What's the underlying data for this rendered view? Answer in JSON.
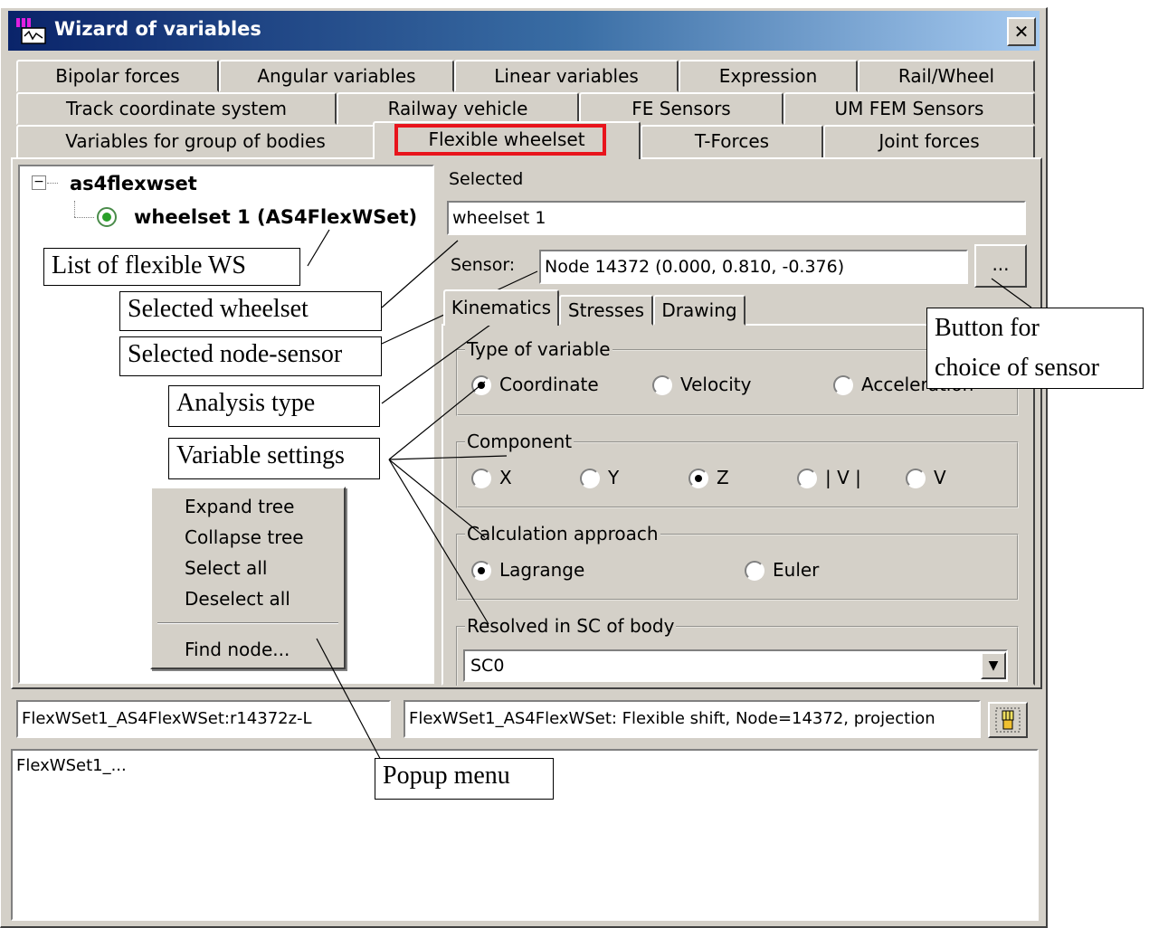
{
  "window": {
    "title": "Wizard of variables",
    "close_label": "✕"
  },
  "tabs": {
    "row1": [
      "Bipolar forces",
      "Angular variables",
      "Linear variables",
      "Expression",
      "Rail/Wheel"
    ],
    "row2": [
      "Track coordinate system",
      "Railway vehicle",
      "FE Sensors",
      "UM FEM Sensors"
    ],
    "row3": [
      "Variables for group of bodies",
      "Flexible wheelset",
      "T-Forces",
      "Joint forces"
    ],
    "active": "Flexible wheelset"
  },
  "tree": {
    "root_toggle": "−",
    "root": "as4flexwset",
    "child": "wheelset 1 (AS4FlexWSet)"
  },
  "selected": {
    "label": "Selected",
    "value": "wheelset 1"
  },
  "sensor": {
    "label": "Sensor:",
    "value": "Node 14372 (0.000,  0.810, -0.376)",
    "button_label": "..."
  },
  "subtabs": [
    "Kinematics",
    "Stresses",
    "Drawing"
  ],
  "type_of_variable": {
    "label": "Type of variable",
    "options": [
      "Coordinate",
      "Velocity",
      "Acceleration"
    ],
    "selected": "Coordinate"
  },
  "component": {
    "label": "Component",
    "options": [
      "X",
      "Y",
      "Z",
      "| V |",
      "V"
    ],
    "selected": "Z"
  },
  "calculation_approach": {
    "label": "Calculation approach",
    "options": [
      "Lagrange",
      "Euler"
    ],
    "selected": "Lagrange"
  },
  "resolved_in": {
    "label": "Resolved in SC of body",
    "value": "SC0",
    "arrow": "▼"
  },
  "context_menu": {
    "items": [
      "Expand tree",
      "Collapse tree",
      "Select all",
      "Deselect all"
    ],
    "find_item": "Find node..."
  },
  "status": {
    "variable_name": "FlexWSet1_AS4FlexWSet:r14372z-L",
    "description": "FlexWSet1_AS4FlexWSet: Flexible shift, Node=14372, projection"
  },
  "output_text": "FlexWSet1_...",
  "callouts": {
    "list_of_flexible_ws": "List of flexible WS",
    "selected_wheelset": "Selected wheelset",
    "selected_node_sensor": "Selected node-sensor",
    "analysis_type": "Analysis type",
    "variable_settings": "Variable settings",
    "button_for_sensor_line1": "Button for",
    "button_for_sensor_line2": "choice of sensor",
    "popup_menu": "Popup menu"
  }
}
